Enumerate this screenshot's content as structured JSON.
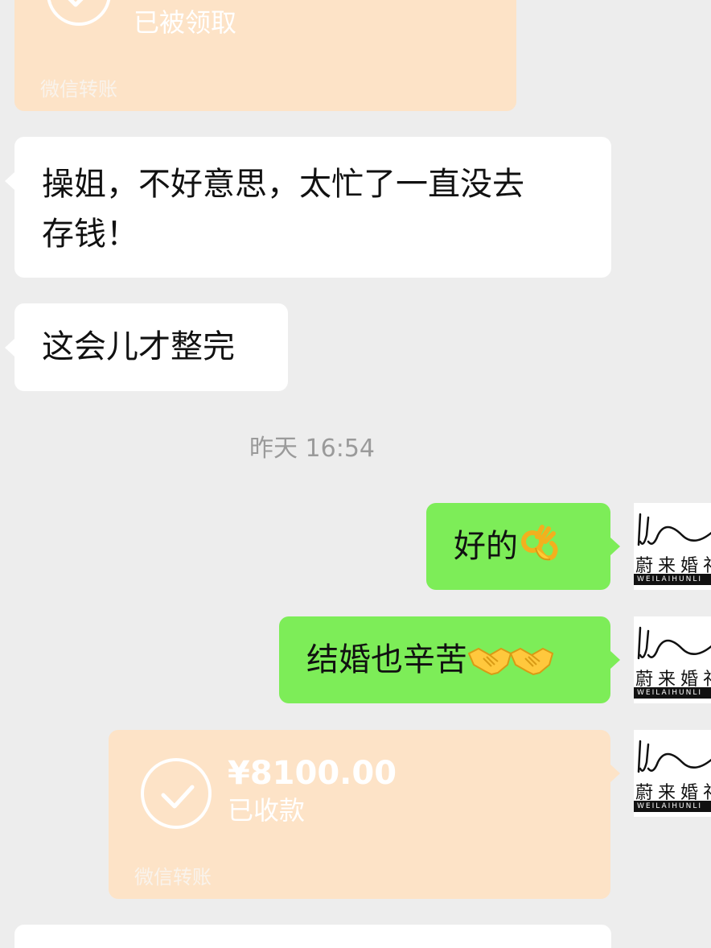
{
  "messages": {
    "top_transfer": {
      "status": "已被领取",
      "footer": "微信转账"
    },
    "msg1": {
      "text_line1": "操姐，不好意思，太忙了一直没去",
      "text_line2": "存钱！"
    },
    "msg2": {
      "text": "这会儿才整完"
    },
    "timestamp": "昨天 16:54",
    "msg3": {
      "text": "好的",
      "emoji": "ok-hand"
    },
    "msg4": {
      "text": "结婚也辛苦",
      "emoji": "handshake"
    },
    "transfer": {
      "amount": "¥8100.00",
      "status": "已收款",
      "footer": "微信转账"
    }
  },
  "avatar": {
    "brand_cn": "蔚来婚礼",
    "brand_en": "WEILAIHUNLI"
  },
  "colors": {
    "background": "#ededed",
    "sent_bubble": "#7ded58",
    "received_bubble": "#ffffff",
    "transfer_card": "#fde3c7"
  }
}
